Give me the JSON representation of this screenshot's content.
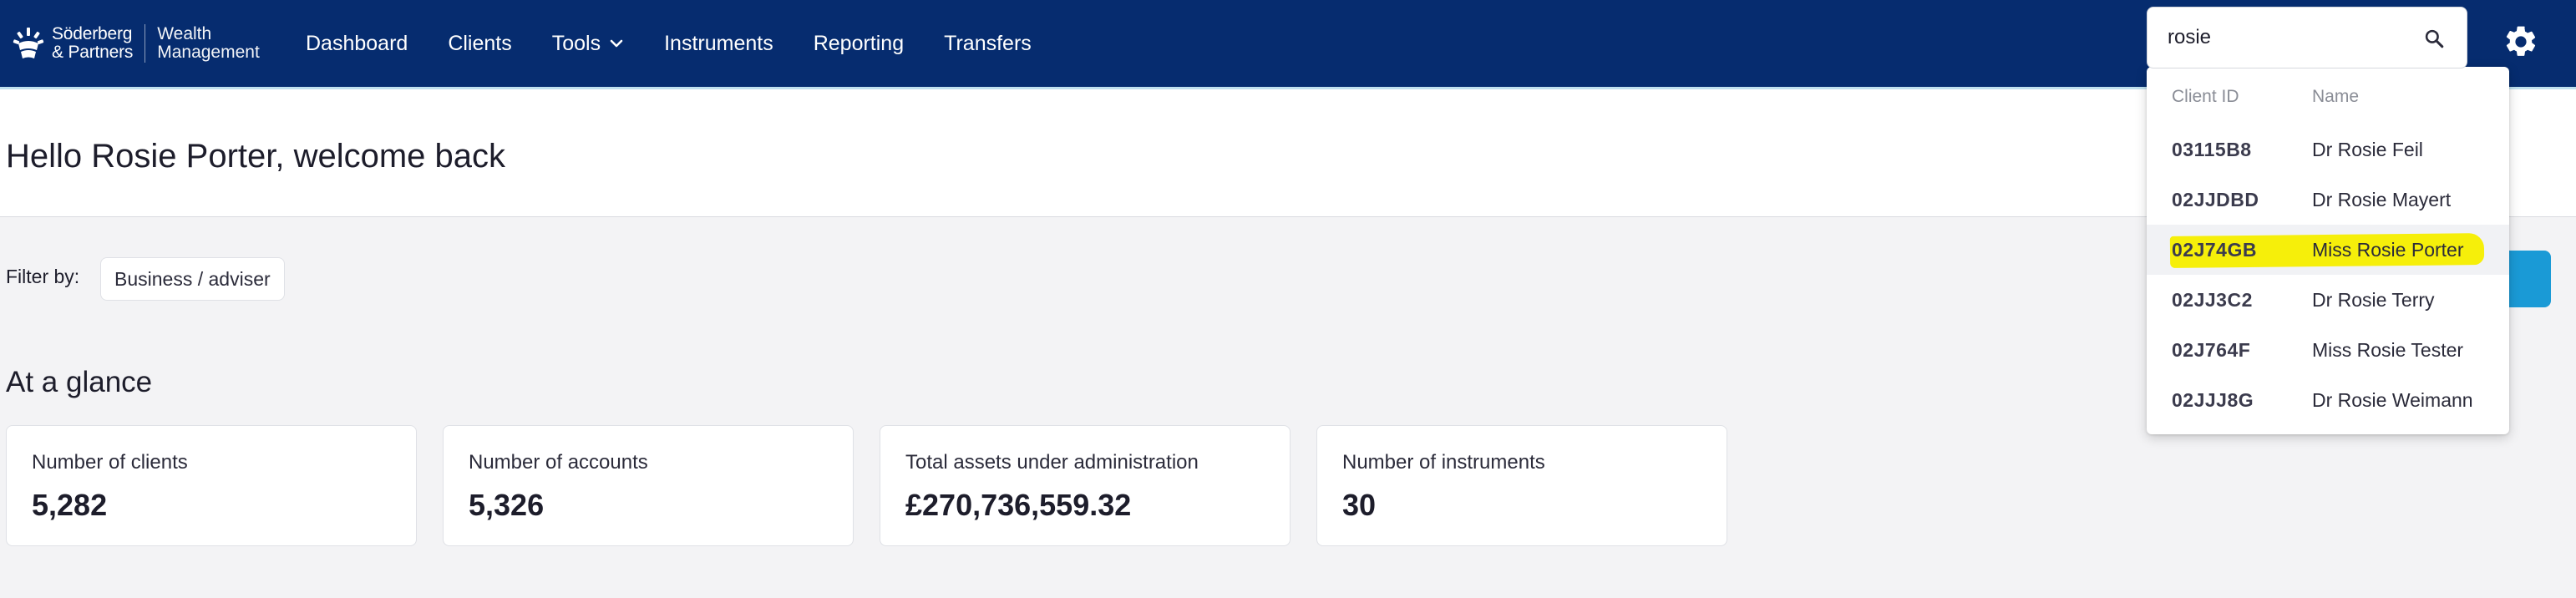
{
  "brand": {
    "name_line1": "Söderberg",
    "name_line2": "& Partners",
    "sub_line1": "Wealth",
    "sub_line2": "Management"
  },
  "nav": {
    "items": [
      {
        "label": "Dashboard"
      },
      {
        "label": "Clients"
      },
      {
        "label": "Tools",
        "has_dropdown": true
      },
      {
        "label": "Instruments"
      },
      {
        "label": "Reporting"
      },
      {
        "label": "Transfers"
      }
    ]
  },
  "search": {
    "value": "rosie",
    "icon": "search-icon",
    "results_header": {
      "client_id": "Client ID",
      "name": "Name"
    },
    "results": [
      {
        "client_id": "03115B8",
        "name": "Dr Rosie Feil"
      },
      {
        "client_id": "02JJDBD",
        "name": "Dr Rosie Mayert"
      },
      {
        "client_id": "02J74GB",
        "name": "Miss Rosie Porter",
        "highlighted": true
      },
      {
        "client_id": "02JJ3C2",
        "name": "Dr Rosie Terry"
      },
      {
        "client_id": "02J764F",
        "name": "Miss Rosie Tester"
      },
      {
        "client_id": "02JJJ8G",
        "name": "Dr Rosie Weimann"
      }
    ]
  },
  "header": {
    "welcome": "Hello Rosie Porter, welcome back"
  },
  "filter": {
    "label": "Filter by:",
    "value": "Business / adviser"
  },
  "glance": {
    "title": "At a glance",
    "cards": [
      {
        "label": "Number of clients",
        "value": "5,282"
      },
      {
        "label": "Number of accounts",
        "value": "5,326"
      },
      {
        "label": "Total assets under administration",
        "value": "£270,736,559.32"
      },
      {
        "label": "Number of instruments",
        "value": "30"
      }
    ]
  },
  "colors": {
    "nav_bg": "#062c6f",
    "accent_blue": "#1a9ad6",
    "highlight": "#f6ef0a",
    "page_bg": "#f3f3f5"
  }
}
